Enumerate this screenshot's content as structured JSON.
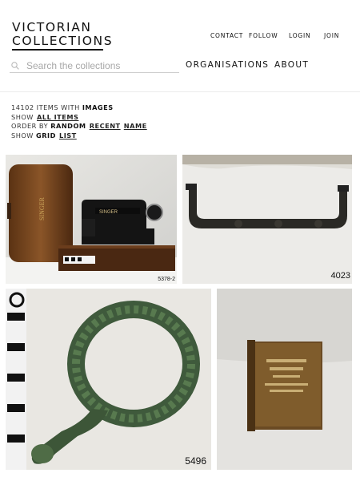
{
  "site": {
    "logo_line1": "VICTORIAN",
    "logo_line2": "COLLECTIONS"
  },
  "topnav": {
    "contact": "CONTACT",
    "follow": "FOLLOW",
    "login": "LOGIN",
    "join": "JOIN"
  },
  "search": {
    "placeholder": "Search the collections",
    "value": ""
  },
  "mainnav": {
    "organisations": "ORGANISATIONS",
    "about": "ABOUT"
  },
  "results": {
    "count": "14102",
    "count_suffix": "ITEMS WITH",
    "images_label": "IMAGES",
    "show_label": "SHOW",
    "all_items": "ALL ITEMS",
    "order_label": "ORDER BY",
    "order_random": "RANDOM",
    "order_recent": "RECENT",
    "order_name": "NAME",
    "view_label": "SHOW",
    "view_grid": "GRID",
    "view_list": "LIST"
  },
  "items": [
    {
      "subject": "sewing machine",
      "number": "5378-2"
    },
    {
      "subject": "metal bracket",
      "number": "4023"
    },
    {
      "subject": "corroded iron ring",
      "number": "5496"
    },
    {
      "subject": "small old book",
      "number": ""
    }
  ],
  "colors": {
    "text": "#111111",
    "muted": "#a8a8a8",
    "rule": "#ececec"
  }
}
